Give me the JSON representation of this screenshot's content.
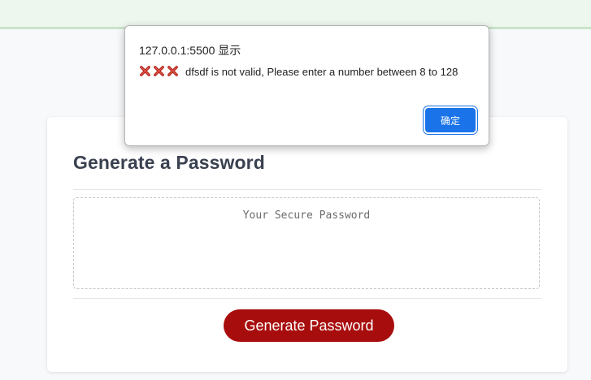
{
  "card": {
    "title": "Generate a Password",
    "password_placeholder": "Your Secure Password",
    "generate_button_label": "Generate Password"
  },
  "alert": {
    "origin": "127.0.0.1:5500 显示",
    "message": "dfsdf is not valid, Please enter a number between 8 to 128",
    "icons": [
      "cross-mark-icon",
      "cross-mark-icon",
      "cross-mark-icon"
    ],
    "ok_label": "确定"
  },
  "colors": {
    "accent_button": "#a80d0d",
    "dialog_button": "#1a73e8",
    "cross_icon": "#b3261e"
  }
}
